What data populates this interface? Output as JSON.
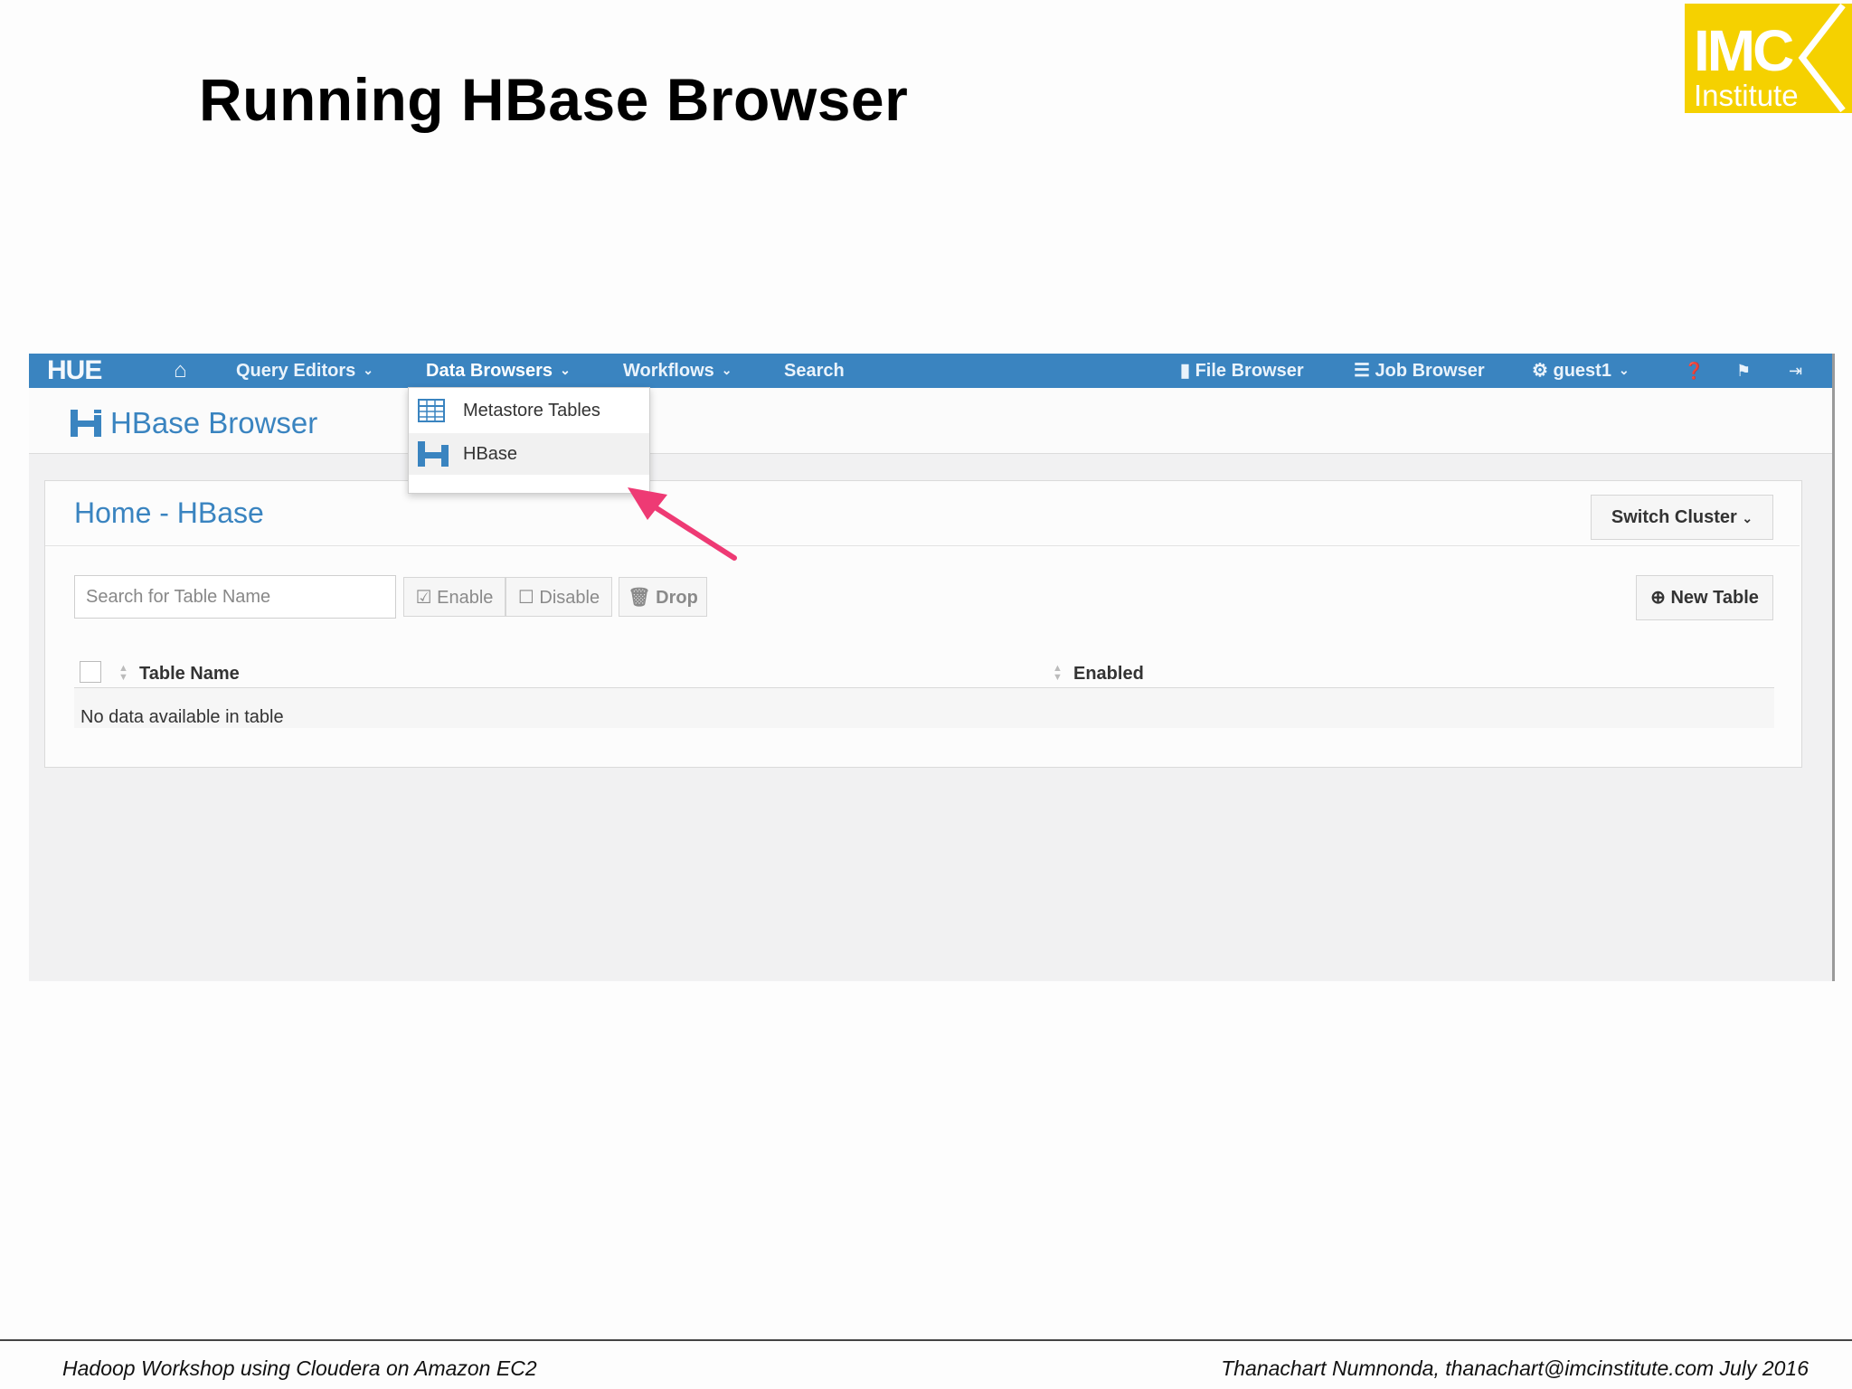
{
  "slide": {
    "title": "Running HBase Browser",
    "logo_line1": "IMC",
    "logo_line2": "Institute",
    "footer_left": "Hadoop Workshop using Cloudera on Amazon EC2",
    "footer_right": "Thanachart Numnonda,  thanachart@imcinstitute.com  July 2016"
  },
  "navbar": {
    "brand": "HUE",
    "items": [
      {
        "label": "Query Editors"
      },
      {
        "label": "Data Browsers"
      },
      {
        "label": "Workflows"
      },
      {
        "label": "Search"
      }
    ],
    "file_browser": "File Browser",
    "job_browser": "Job Browser",
    "user": "guest1"
  },
  "dropdown": {
    "items": [
      {
        "label": "Metastore Tables",
        "icon": "table-icon"
      },
      {
        "label": "HBase",
        "icon": "hbase-icon"
      }
    ]
  },
  "app": {
    "title": "HBase Browser",
    "breadcrumb": "Home - HBase",
    "switch_cluster": "Switch Cluster",
    "new_table": "New Table",
    "search_placeholder": "Search for Table Name",
    "enable": "Enable",
    "disable": "Disable",
    "drop": "Drop",
    "columns": [
      "Table Name",
      "Enabled"
    ],
    "empty_message": "No data available in table"
  },
  "colors": {
    "nav_blue": "#3a84c0",
    "logo_yellow": "#f5d100",
    "arrow_pink": "#ee3a74"
  }
}
